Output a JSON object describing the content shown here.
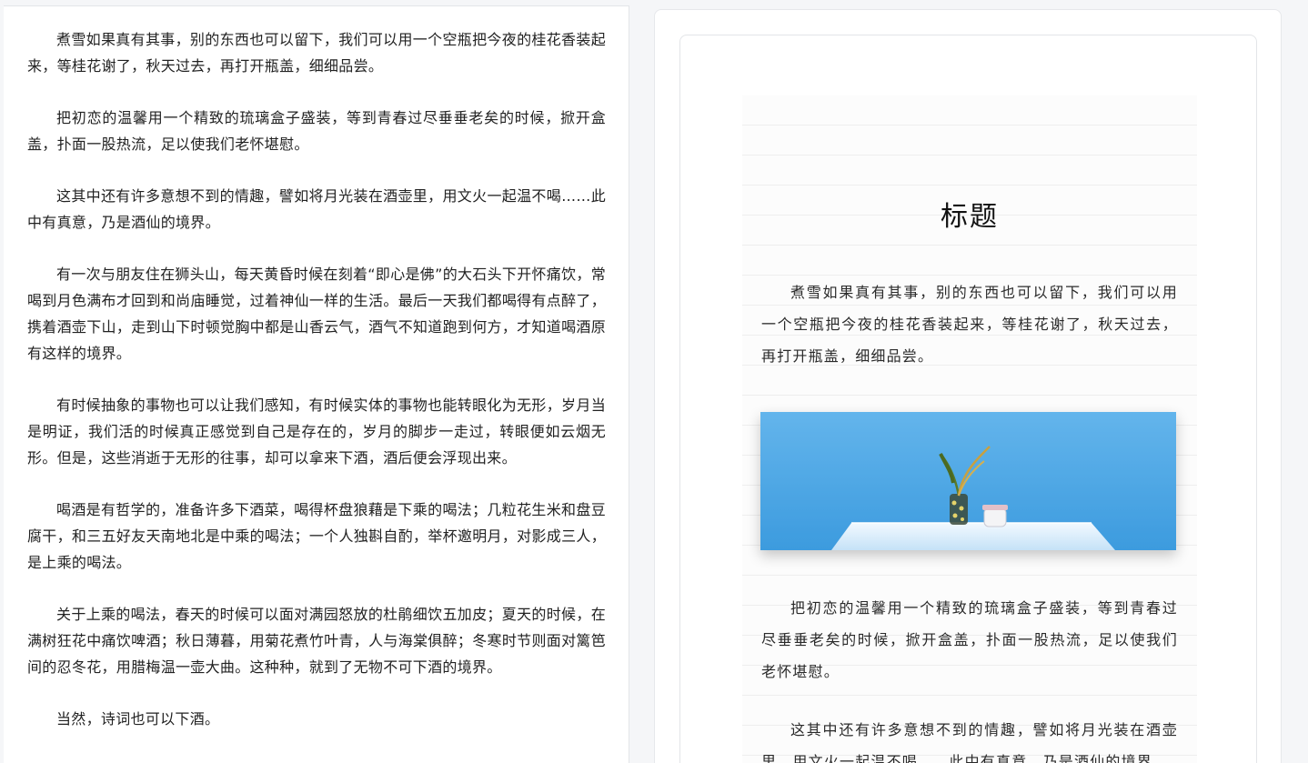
{
  "editor": {
    "paragraphs": [
      "煮雪如果真有其事，别的东西也可以留下，我们可以用一个空瓶把今夜的桂花香装起来，等桂花谢了，秋天过去，再打开瓶盖，细细品尝。",
      "把初恋的温馨用一个精致的琉璃盒子盛装，等到青春过尽垂垂老矣的时候，掀开盒盖，扑面一股热流，足以使我们老怀堪慰。",
      "这其中还有许多意想不到的情趣，譬如将月光装在酒壶里，用文火一起温不喝……此中有真意，乃是酒仙的境界。",
      "有一次与朋友住在狮头山，每天黄昏时候在刻着“即心是佛”的大石头下开怀痛饮，常喝到月色满布才回到和尚庙睡觉，过着神仙一样的生活。最后一天我们都喝得有点醉了，携着酒壶下山，走到山下时顿觉胸中都是山香云气，酒气不知道跑到何方，才知道喝酒原有这样的境界。",
      "有时候抽象的事物也可以让我们感知，有时候实体的事物也能转眼化为无形，岁月当是明证，我们活的时候真正感觉到自己是存在的，岁月的脚步一走过，转眼便如云烟无形。但是，这些消逝于无形的往事，却可以拿来下酒，酒后便会浮现出来。",
      "喝酒是有哲学的，准备许多下酒菜，喝得杯盘狼藉是下乘的喝法；几粒花生米和盘豆腐干，和三五好友天南地北是中乘的喝法；一个人独斟自酌，举杯邀明月，对影成三人，是上乘的喝法。",
      "关于上乘的喝法，春天的时候可以面对满园怒放的杜鹃细饮五加皮；夏天的时候，在满树狂花中痛饮啤酒；秋日薄暮，用菊花煮竹叶青，人与海棠俱醉；冬寒时节则面对篱笆间的忍冬花，用腊梅温一壶大曲。这种种，就到了无物不可下酒的境界。",
      "当然，诗词也可以下酒。"
    ]
  },
  "preview": {
    "title": "标题",
    "para1": "煮雪如果真有其事，别的东西也可以留下，我们可以用一个空瓶把今夜的桂花香装起来，等桂花谢了，秋天过去，再打开瓶盖，细细品尝。",
    "para2": "把初恋的温馨用一个精致的琉璃盒子盛装，等到青春过尽垂垂老矣的时候，掀开盒盖，扑面一股热流，足以使我们老怀堪慰。",
    "para3": "这其中还有许多意想不到的情趣，譬如将月光装在酒壶里，用文火一起温不喝……此中有真意，乃是酒仙的境界。",
    "image_colors": {
      "wall": "#4aa7e6",
      "table": "#d8ecfb"
    }
  }
}
